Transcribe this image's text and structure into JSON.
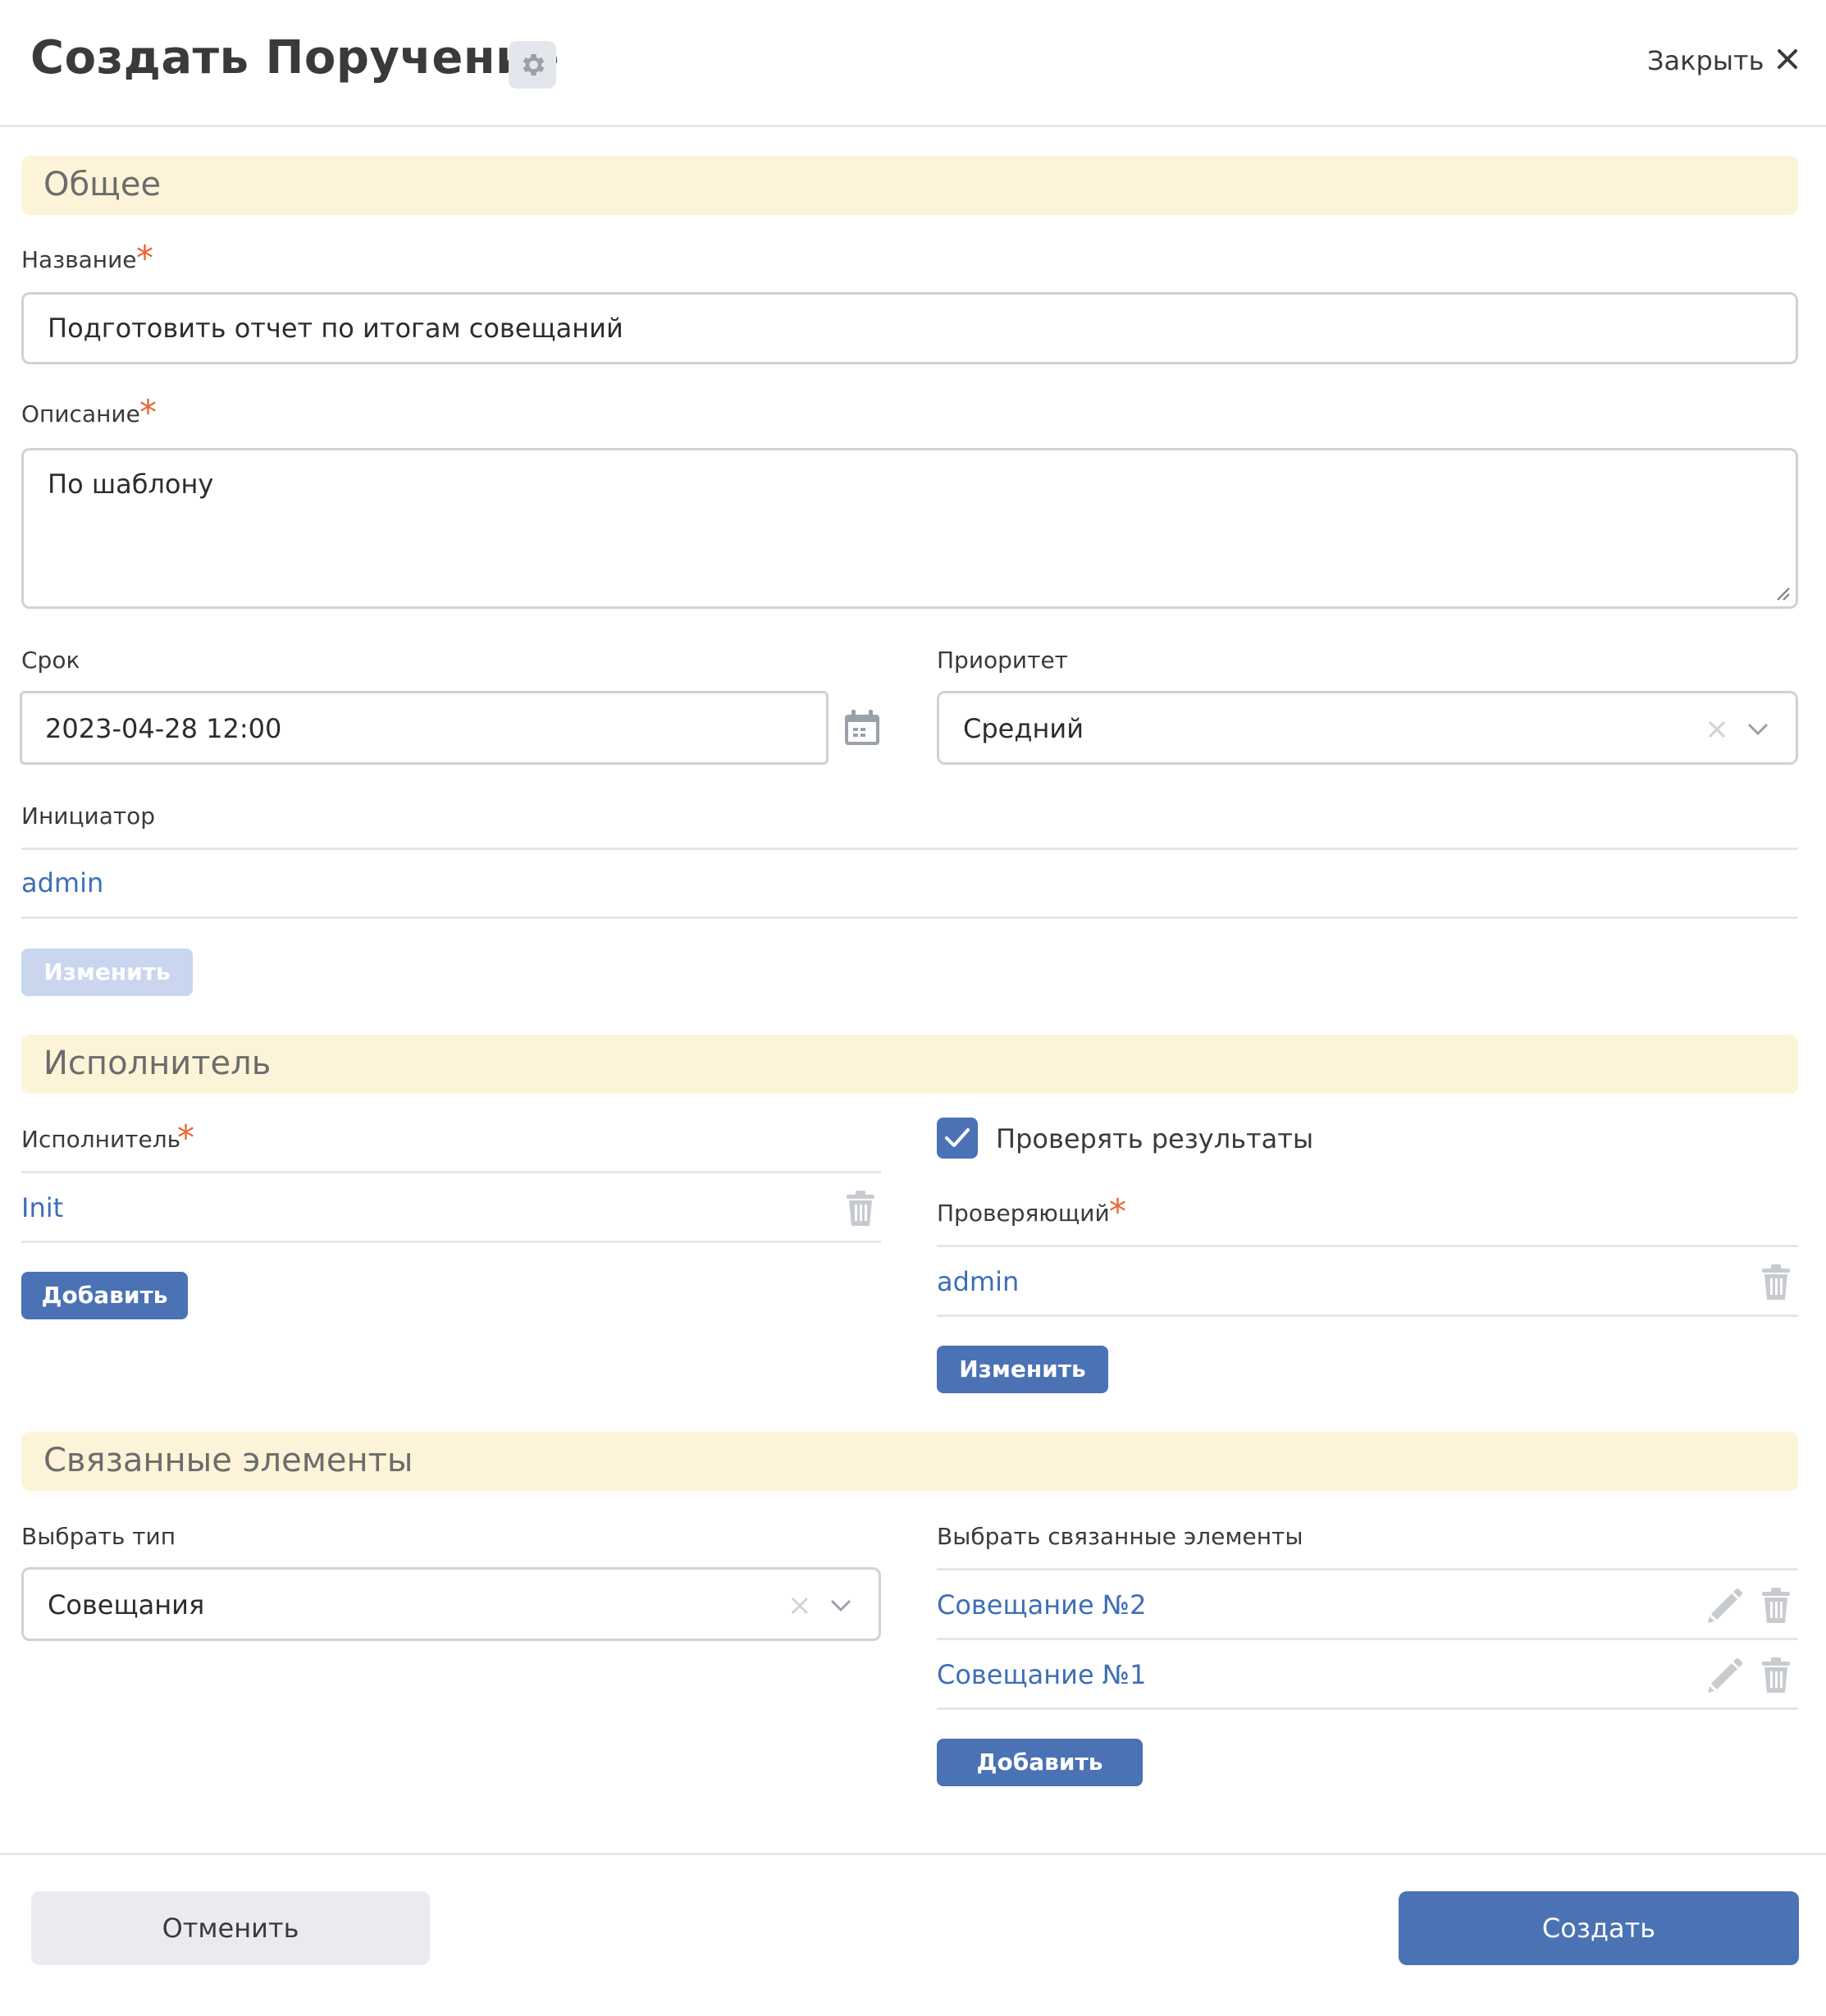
{
  "header": {
    "title": "Создать Поручение",
    "close_label": "Закрыть"
  },
  "general": {
    "section_title": "Общее",
    "name_label": "Название",
    "name_value": "Подготовить отчет по итогам совещаний",
    "description_label": "Описание",
    "description_value": "По шаблону",
    "deadline_label": "Срок",
    "deadline_value": "2023-04-28 12:00",
    "priority_label": "Приоритет",
    "priority_value": "Средний",
    "initiator_label": "Инициатор",
    "initiator_value": "admin",
    "initiator_change_label": "Изменить"
  },
  "executor": {
    "section_title": "Исполнитель",
    "executor_label": "Исполнитель",
    "executor_value": "Init",
    "add_label": "Добавить",
    "check_results_label": "Проверять результаты",
    "check_results_checked": true,
    "reviewer_label": "Проверяющий",
    "reviewer_value": "admin",
    "reviewer_change_label": "Изменить"
  },
  "related": {
    "section_title": "Связанные элементы",
    "type_label": "Выбрать тип",
    "type_value": "Совещания",
    "elements_label": "Выбрать связанные элементы",
    "items": [
      "Совещание №2",
      "Совещание №1"
    ],
    "add_label": "Добавить"
  },
  "footer": {
    "cancel_label": "Отменить",
    "create_label": "Создать"
  },
  "colors": {
    "primary": "#4a72b4",
    "section_bg": "#fdf3d8",
    "required": "#e86632",
    "link": "#3d6fb6"
  }
}
